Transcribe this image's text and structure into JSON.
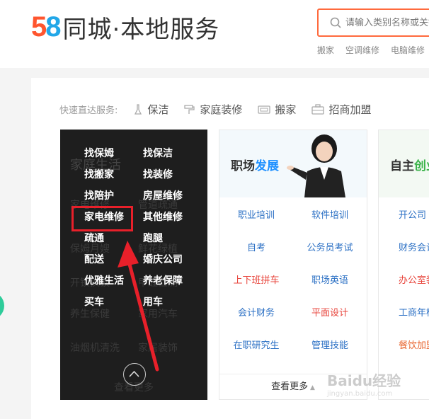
{
  "header": {
    "logo_num_1": "5",
    "logo_num_2": "8",
    "title": "同城·本地服务",
    "search_placeholder": "请输入类别名称或关键字",
    "hot_links": [
      "搬家",
      "空调维修",
      "电脑维修"
    ]
  },
  "quick": {
    "label": "快速直达服务:",
    "items": [
      {
        "label": "保洁",
        "icon": "broom-icon"
      },
      {
        "label": "家庭装修",
        "icon": "paint-roller-icon"
      },
      {
        "label": "搬家",
        "icon": "truck-icon"
      },
      {
        "label": "招商加盟",
        "icon": "briefcase-icon"
      }
    ]
  },
  "dark_panel": {
    "ghost_title": "家庭生活",
    "ghost_items": [
      "家电维修",
      "管道疏通",
      "保姆月嫂",
      "鲜花绿植",
      "开锁换锁",
      "甲醛检测",
      "宠物服务",
      "养生保健",
      "油烟机清洗",
      "家用汽车",
      "家居装饰",
      "管道疏通",
      "查看更多"
    ],
    "menu": [
      "找保姆",
      "找保洁",
      "找搬家",
      "找装修",
      "找陪护",
      "房屋维修",
      "家电维修",
      "其他维修",
      "疏通",
      "跑腿",
      "配送",
      "婚庆公司",
      "优雅生活",
      "养老保障",
      "买车",
      "用车"
    ]
  },
  "card_career": {
    "title_1": "职场",
    "title_2": "发展",
    "links": [
      [
        "职业培训",
        "软件培训"
      ],
      [
        "自考",
        "公务员考试"
      ],
      [
        "上下班拼车",
        "职场英语"
      ],
      [
        "会计财务",
        "平面设计"
      ],
      [
        "在职研究生",
        "管理技能"
      ]
    ],
    "more": "查看更多"
  },
  "card_business": {
    "title_1": "自主",
    "title_2": "创业",
    "links": [
      "开公司",
      "财务会计",
      "办公室装修",
      "工商年检",
      "餐饮加盟"
    ]
  },
  "watermark": {
    "brand": "Baidu经验",
    "url": "jingyan.baidu.com"
  },
  "colors": {
    "brand_orange": "#ff552e",
    "brand_blue": "#22a7e8",
    "highlight_red": "#e8202a",
    "link_blue": "#2a6fc4"
  }
}
